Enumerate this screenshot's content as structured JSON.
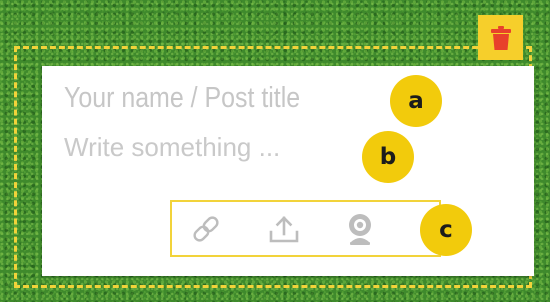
{
  "composer": {
    "title_placeholder": "Your name / Post title",
    "body_placeholder": "Write something ..."
  },
  "annotations": {
    "a": "a",
    "b": "b",
    "c": "c"
  },
  "toolbar": {
    "icons": [
      "link-icon",
      "upload-icon",
      "webcam-icon"
    ]
  },
  "delete": {
    "icon": "trash-icon"
  },
  "colors": {
    "highlight_yellow": "#f2d33a",
    "badge_yellow": "#f2cb0c",
    "trash_red": "#e8412b",
    "background_green": "#3f8a2c",
    "placeholder_gray": "#c6c6c6",
    "icon_gray": "#bdbdbd"
  }
}
